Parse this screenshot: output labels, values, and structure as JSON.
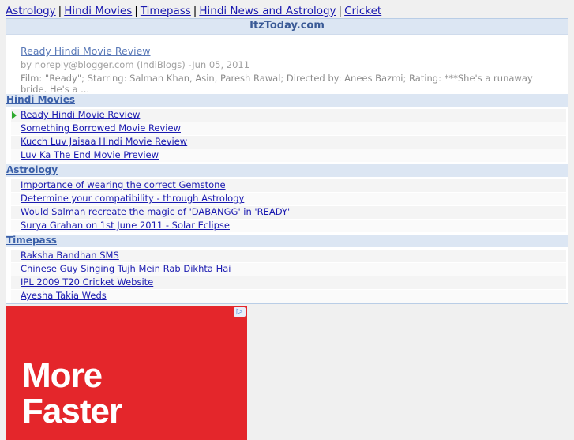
{
  "topnav": {
    "links": [
      "Astrology",
      "Hindi Movies",
      "Timepass",
      "Hindi News and Astrology",
      "Cricket"
    ],
    "separator": "|"
  },
  "widget": {
    "title": "ItzToday.com",
    "feature": {
      "title": "Ready Hindi Movie Review",
      "meta": "by noreply@blogger.com (IndiBlogs) -Jun 05, 2011",
      "description": "Film: \"Ready\"; Starring: Salman Khan, Asin, Paresh Rawal; Directed by: Anees Bazmi; Rating: ***She's a runaway bride. He's a ..."
    },
    "sections": [
      {
        "name": "Hindi Movies",
        "items": [
          "Ready Hindi Movie Review",
          "Something Borrowed Movie Review",
          "Kucch Luv Jaisaa Hindi Movie Review",
          "Luv Ka The End Movie Preview"
        ]
      },
      {
        "name": "Astrology",
        "items": [
          "Importance of wearing the correct Gemstone",
          "Determine your compatibility - through Astrology",
          "Would Salman recreate the magic of 'DABANGG' in 'READY'",
          "Surya Grahan on 1st June 2011 - Solar Eclipse"
        ]
      },
      {
        "name": "Timepass",
        "items": [
          "Raksha Bandhan SMS",
          "Chinese Guy Singing Tujh Mein Rab Dikhta Hai",
          "IPL 2009 T20 Cricket Website",
          "Ayesha Takia Weds"
        ]
      }
    ]
  },
  "ad": {
    "text_line1": "More",
    "text_line2": "Faster",
    "adchoices_icon": "adchoices-icon",
    "color": "#e4262b"
  }
}
